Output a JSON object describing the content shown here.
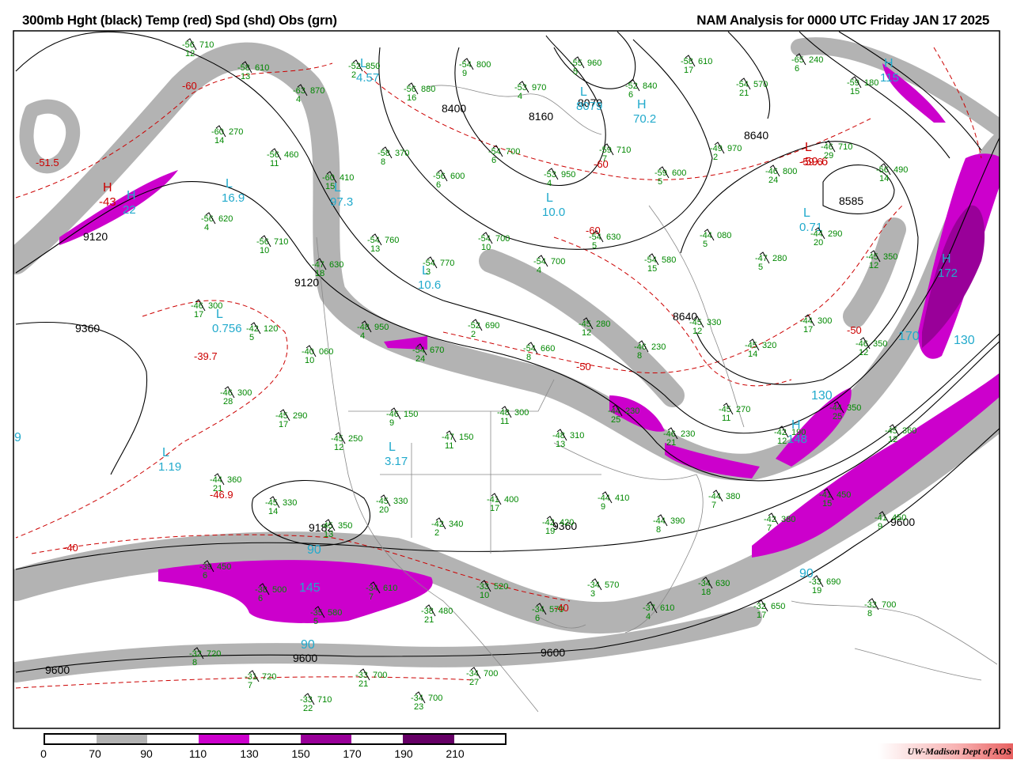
{
  "header": {
    "title_left": "300mb Hght (black) Temp (red) Spd (shd) Obs (grn)",
    "title_right": "NAM Analysis for 0000 UTC Friday  JAN 17 2025"
  },
  "colors": {
    "gray": "#b3b3b3",
    "magenta": "#cc00cc",
    "purple": "#990099",
    "darkpurple": "#660066",
    "height": "#000000",
    "temp": "#cc0000",
    "obs": "#008800",
    "speed_label": "#22aacc"
  },
  "legend": {
    "labels": [
      "0",
      "70",
      "90",
      "110",
      "130",
      "150",
      "170",
      "190",
      "210"
    ]
  },
  "credit": "UW-Madison  Dept of AOS",
  "height_labels": [
    "8400",
    "8160",
    "8079",
    "8640",
    "8585",
    "9120",
    "9120",
    "9360",
    "8640",
    "9182",
    "9360",
    "9600",
    "9600",
    "9600",
    "9600"
  ],
  "temp_labels": [
    "-60",
    "-51.5",
    "-60",
    "-60",
    "-59.6",
    "-39.7",
    "-46.9",
    "-40",
    "-50",
    "-40",
    "-50"
  ],
  "highs_lows": [
    {
      "type": "H",
      "value": "-43"
    },
    {
      "type": "H",
      "value": "22"
    },
    {
      "type": "L",
      "value": "16.9"
    },
    {
      "type": "L",
      "value": "4.57"
    },
    {
      "type": "L",
      "value": "97.3"
    },
    {
      "type": "L",
      "value": "10.6"
    },
    {
      "type": "L",
      "value": "0.756"
    },
    {
      "type": "L",
      "value": "1.19"
    },
    {
      "type": "L",
      "value": "3.17"
    },
    {
      "type": "L",
      "value": "10.0"
    },
    {
      "type": "H",
      "value": "70.2"
    },
    {
      "type": "L",
      "value": "8079"
    },
    {
      "type": "H",
      "value": "115"
    },
    {
      "type": "L",
      "value": "0.71"
    },
    {
      "type": "H",
      "value": "172"
    },
    {
      "type": "H",
      "value": "148"
    },
    {
      "type": "L",
      "value": "-59.6"
    }
  ],
  "speed_labels": [
    "90",
    "90",
    "145",
    "130",
    "170",
    "130",
    "90",
    "9"
  ],
  "obs": [
    {
      "t": "-56",
      "h": "710",
      "d": "12"
    },
    {
      "t": "-58",
      "h": "610",
      "d": "13"
    },
    {
      "t": "-63",
      "h": "870",
      "d": "4"
    },
    {
      "t": "-52",
      "h": "850",
      "d": "2"
    },
    {
      "t": "-56",
      "h": "880",
      "d": "16"
    },
    {
      "t": "-54",
      "h": "800",
      "d": "9"
    },
    {
      "t": "-53",
      "h": "970",
      "d": "4"
    },
    {
      "t": "-55",
      "h": "960",
      "d": "5"
    },
    {
      "t": "-52",
      "h": "840",
      "d": "6"
    },
    {
      "t": "-58",
      "h": "610",
      "d": "17"
    },
    {
      "t": "-54",
      "h": "570",
      "d": "21"
    },
    {
      "t": "-65",
      "h": "240",
      "d": "6"
    },
    {
      "t": "-59",
      "h": "180",
      "d": "15"
    },
    {
      "t": "-60",
      "h": "270",
      "d": "14"
    },
    {
      "t": "-56",
      "h": "460",
      "d": "11"
    },
    {
      "t": "-60",
      "h": "410",
      "d": "15"
    },
    {
      "t": "-58",
      "h": "370",
      "d": "8"
    },
    {
      "t": "-56",
      "h": "600",
      "d": "6"
    },
    {
      "t": "-54",
      "h": "700",
      "d": "6"
    },
    {
      "t": "-53",
      "h": "950",
      "d": "4"
    },
    {
      "t": "-59",
      "h": "710",
      "d": "7"
    },
    {
      "t": "-59",
      "h": "600",
      "d": "5"
    },
    {
      "t": "-49",
      "h": "970",
      "d": "2"
    },
    {
      "t": "-46",
      "h": "800",
      "d": "24"
    },
    {
      "t": "-46",
      "h": "710",
      "d": "29"
    },
    {
      "t": "-56",
      "h": "490",
      "d": "14"
    },
    {
      "t": "-56",
      "h": "620",
      "d": "4"
    },
    {
      "t": "-56",
      "h": "710",
      "d": "10"
    },
    {
      "t": "-47",
      "h": "630",
      "d": "18"
    },
    {
      "t": "-54",
      "h": "760",
      "d": "13"
    },
    {
      "t": "-54",
      "h": "770",
      "d": "3"
    },
    {
      "t": "-54",
      "h": "700",
      "d": "10"
    },
    {
      "t": "-54",
      "h": "700",
      "d": "4"
    },
    {
      "t": "-54",
      "h": "630",
      "d": "5"
    },
    {
      "t": "-54",
      "h": "580",
      "d": "15"
    },
    {
      "t": "-44",
      "h": "080",
      "d": "5"
    },
    {
      "t": "-47",
      "h": "280",
      "d": "5"
    },
    {
      "t": "-44",
      "h": "290",
      "d": "20"
    },
    {
      "t": "-45",
      "h": "350",
      "d": "12"
    },
    {
      "t": "-46",
      "h": "300",
      "d": "17"
    },
    {
      "t": "-42",
      "h": "120",
      "d": "5"
    },
    {
      "t": "-40",
      "h": "060",
      "d": "10"
    },
    {
      "t": "-48",
      "h": "950",
      "d": "4"
    },
    {
      "t": "-54",
      "h": "670",
      "d": "24"
    },
    {
      "t": "-52",
      "h": "690",
      "d": "2"
    },
    {
      "t": "-54",
      "h": "660",
      "d": "8"
    },
    {
      "t": "-45",
      "h": "280",
      "d": "12"
    },
    {
      "t": "-46",
      "h": "230",
      "d": "8"
    },
    {
      "t": "-45",
      "h": "330",
      "d": "12"
    },
    {
      "t": "-45",
      "h": "320",
      "d": "14"
    },
    {
      "t": "-44",
      "h": "300",
      "d": "17"
    },
    {
      "t": "-46",
      "h": "350",
      "d": "12"
    },
    {
      "t": "-46",
      "h": "300",
      "d": "28"
    },
    {
      "t": "-45",
      "h": "290",
      "d": "17"
    },
    {
      "t": "-45",
      "h": "250",
      "d": "12"
    },
    {
      "t": "-46",
      "h": "150",
      "d": "9"
    },
    {
      "t": "-47",
      "h": "150",
      "d": "11"
    },
    {
      "t": "-48",
      "h": "300",
      "d": "11"
    },
    {
      "t": "-48",
      "h": "310",
      "d": "13"
    },
    {
      "t": "-44",
      "h": "230",
      "d": "25"
    },
    {
      "t": "-46",
      "h": "230",
      "d": "21"
    },
    {
      "t": "-45",
      "h": "270",
      "d": "11"
    },
    {
      "t": "-42",
      "h": "190",
      "d": "12"
    },
    {
      "t": "-44",
      "h": "350",
      "d": "25"
    },
    {
      "t": "-45",
      "h": "360",
      "d": "12"
    },
    {
      "t": "-44",
      "h": "360",
      "d": "21"
    },
    {
      "t": "-45",
      "h": "330",
      "d": "14"
    },
    {
      "t": "-45",
      "h": "350",
      "d": "13"
    },
    {
      "t": "-45",
      "h": "330",
      "d": "20"
    },
    {
      "t": "-42",
      "h": "340",
      "d": "2"
    },
    {
      "t": "-41",
      "h": "400",
      "d": "17"
    },
    {
      "t": "-42",
      "h": "420",
      "d": "19"
    },
    {
      "t": "-44",
      "h": "410",
      "d": "9"
    },
    {
      "t": "-44",
      "h": "390",
      "d": "8"
    },
    {
      "t": "-44",
      "h": "380",
      "d": "7"
    },
    {
      "t": "-42",
      "h": "380",
      "d": "7"
    },
    {
      "t": "-41",
      "h": "450",
      "d": "15"
    },
    {
      "t": "-41",
      "h": "450",
      "d": "9"
    },
    {
      "t": "-39",
      "h": "450",
      "d": "6"
    },
    {
      "t": "-38",
      "h": "500",
      "d": "6"
    },
    {
      "t": "-35",
      "h": "580",
      "d": "5"
    },
    {
      "t": "-34",
      "h": "610",
      "d": "7"
    },
    {
      "t": "-38",
      "h": "480",
      "d": "21"
    },
    {
      "t": "-33",
      "h": "520",
      "d": "10"
    },
    {
      "t": "-34",
      "h": "570",
      "d": "6"
    },
    {
      "t": "-34",
      "h": "570",
      "d": "3"
    },
    {
      "t": "-37",
      "h": "610",
      "d": "4"
    },
    {
      "t": "-34",
      "h": "630",
      "d": "18"
    },
    {
      "t": "-32",
      "h": "650",
      "d": "17"
    },
    {
      "t": "-33",
      "h": "690",
      "d": "19"
    },
    {
      "t": "-33",
      "h": "700",
      "d": "8"
    },
    {
      "t": "-32",
      "h": "720",
      "d": "8"
    },
    {
      "t": "-31",
      "h": "720",
      "d": "7"
    },
    {
      "t": "-33",
      "h": "710",
      "d": "22"
    },
    {
      "t": "-33",
      "h": "700",
      "d": "21"
    },
    {
      "t": "-34",
      "h": "700",
      "d": "23"
    },
    {
      "t": "-34",
      "h": "700",
      "d": "27"
    }
  ]
}
